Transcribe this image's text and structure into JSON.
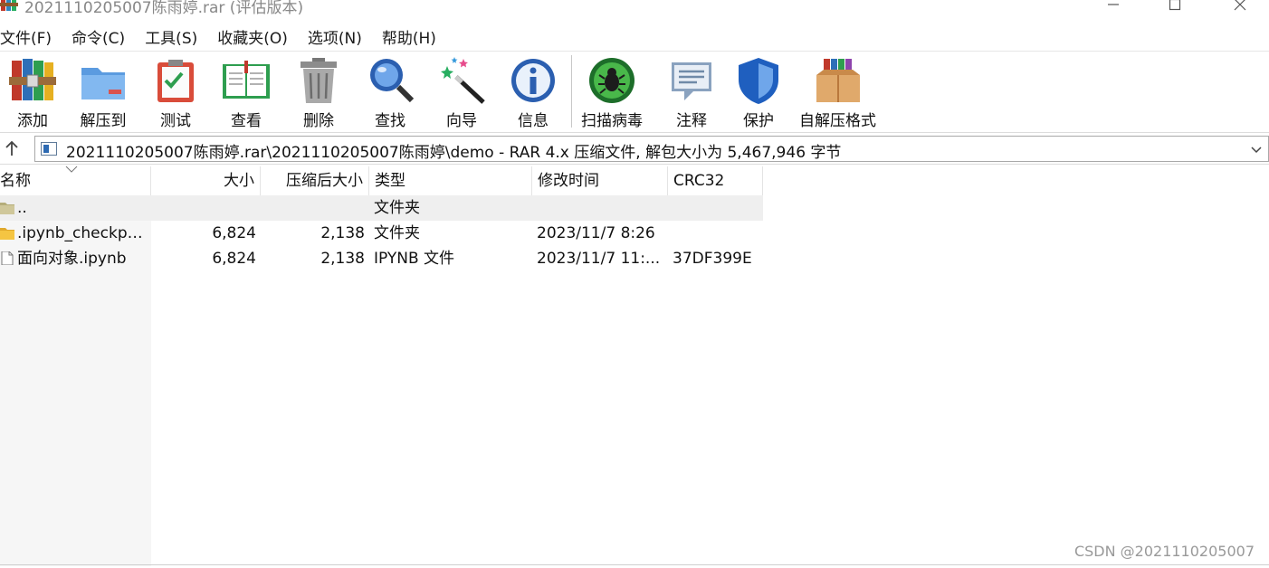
{
  "window": {
    "title": "2021110205007陈雨婷.rar (评估版本)",
    "controls": {
      "minimize": "—",
      "maximize": "☐",
      "close": "✕"
    }
  },
  "menu": [
    {
      "label": "文件(F)"
    },
    {
      "label": "命令(C)"
    },
    {
      "label": "工具(S)"
    },
    {
      "label": "收藏夹(O)"
    },
    {
      "label": "选项(N)"
    },
    {
      "label": "帮助(H)"
    }
  ],
  "toolbar": {
    "buttons": [
      {
        "label": "添加",
        "icon": "add-books-icon"
      },
      {
        "label": "解压到",
        "icon": "extract-folder-icon"
      },
      {
        "label": "测试",
        "icon": "test-clipboard-icon"
      },
      {
        "label": "查看",
        "icon": "view-book-icon"
      },
      {
        "label": "删除",
        "icon": "trash-icon"
      },
      {
        "label": "查找",
        "icon": "magnifier-icon"
      },
      {
        "label": "向导",
        "icon": "wizard-wand-icon"
      },
      {
        "label": "信息",
        "icon": "info-icon"
      },
      {
        "label": "扫描病毒",
        "icon": "virus-scan-icon"
      },
      {
        "label": "注释",
        "icon": "comment-icon"
      },
      {
        "label": "保护",
        "icon": "shield-icon"
      },
      {
        "label": "自解压格式",
        "icon": "sfx-box-icon"
      }
    ]
  },
  "address": {
    "path": "2021110205007陈雨婷.rar\\2021110205007陈雨婷\\demo - RAR 4.x 压缩文件, 解包大小为 5,467,946 字节"
  },
  "columns": {
    "name": "名称",
    "size": "大小",
    "packed": "压缩后大小",
    "type": "类型",
    "modified": "修改时间",
    "crc": "CRC32"
  },
  "rows": [
    {
      "name": "..",
      "size": "",
      "packed": "",
      "type": "文件夹",
      "modified": "",
      "crc": "",
      "icon": "parent-folder-icon"
    },
    {
      "name": ".ipynb_checkpo...",
      "size": "6,824",
      "packed": "2,138",
      "type": "文件夹",
      "modified": "2023/11/7 8:26",
      "crc": "",
      "icon": "folder-icon"
    },
    {
      "name": "面向对象.ipynb",
      "size": "6,824",
      "packed": "2,138",
      "type": "IPYNB 文件",
      "modified": "2023/11/7 11:...",
      "crc": "37DF399E",
      "icon": "file-icon"
    }
  ],
  "watermark": "CSDN @2021110205007",
  "colors": {
    "selected_row": "#efefef",
    "folder": "#f5c542",
    "accent_blue": "#2d6ab3"
  }
}
